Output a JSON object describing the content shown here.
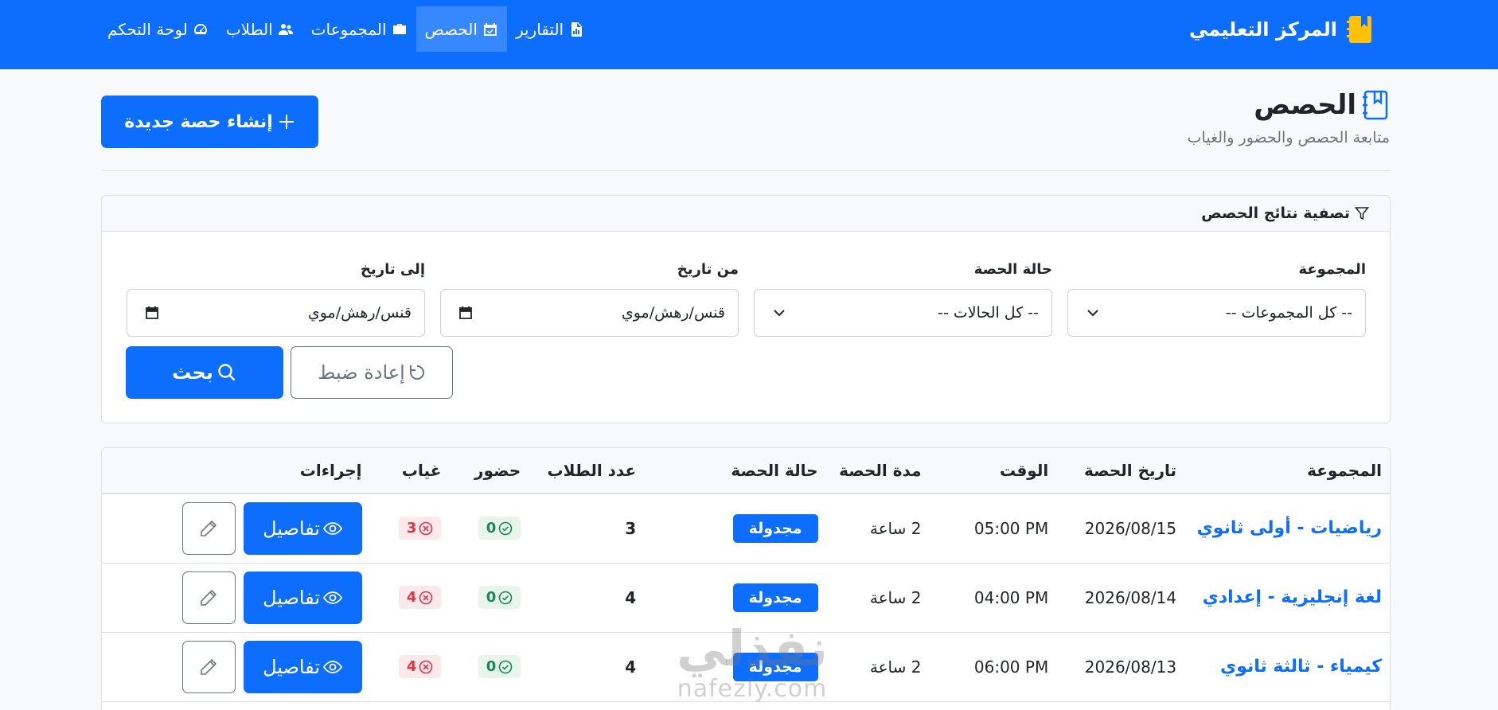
{
  "navbar": {
    "brand": "المركز التعليمي",
    "items": [
      {
        "label": "لوحة التحكم",
        "icon": "speedometer-icon",
        "active": false
      },
      {
        "label": "الطلاب",
        "icon": "people-icon",
        "active": false
      },
      {
        "label": "المجموعات",
        "icon": "briefcase-icon",
        "active": false
      },
      {
        "label": "الحصص",
        "icon": "calendar-check-icon",
        "active": true
      },
      {
        "label": "التقارير",
        "icon": "file-chart-icon",
        "active": false
      }
    ]
  },
  "header": {
    "title": "الحصص",
    "subtitle": "متابعة الحصص والحضور والغياب",
    "create_label": "إنشاء حصة جديدة"
  },
  "filter": {
    "title": "تصفية نتائج الحصص",
    "group_label": "المجموعة",
    "group_value": "-- كل المجموعات --",
    "status_label": "حالة الحصة",
    "status_value": "-- كل الحالات --",
    "from_label": "من تاريخ",
    "from_placeholder": "قنس/رهش/موي",
    "to_label": "إلى تاريخ",
    "to_placeholder": "قنس/رهش/موي",
    "search_label": "بحث",
    "reset_label": "إعادة ضبط"
  },
  "table": {
    "columns": {
      "group": "المجموعة",
      "date": "تاريخ الحصة",
      "time": "الوقت",
      "duration": "مدة الحصة",
      "status": "حالة الحصة",
      "students": "عدد الطلاب",
      "present": "حضور",
      "absent": "غياب",
      "actions": "إجراءات"
    },
    "details_label": "تفاصيل",
    "rows": [
      {
        "group": "رياضيات - أولى ثانوي",
        "date": "2026/08/15",
        "time": "05:00 PM",
        "duration": "2 ساعة",
        "status": "مجدولة",
        "students": "3",
        "present": "0",
        "absent": "3"
      },
      {
        "group": "لغة إنجليزية - إعدادي",
        "date": "2026/08/14",
        "time": "04:00 PM",
        "duration": "2 ساعة",
        "status": "مجدولة",
        "students": "4",
        "present": "0",
        "absent": "4"
      },
      {
        "group": "كيمياء - ثالثة ثانوي",
        "date": "2026/08/13",
        "time": "06:00 PM",
        "duration": "2 ساعة",
        "status": "مجدولة",
        "students": "4",
        "present": "0",
        "absent": "4"
      }
    ]
  },
  "watermark": {
    "main": "نفذلي",
    "sub": "nafezly.com"
  },
  "colors": {
    "primary": "#0d6efd",
    "success": "#198754",
    "danger": "#dc3545",
    "muted": "#6c757d"
  }
}
